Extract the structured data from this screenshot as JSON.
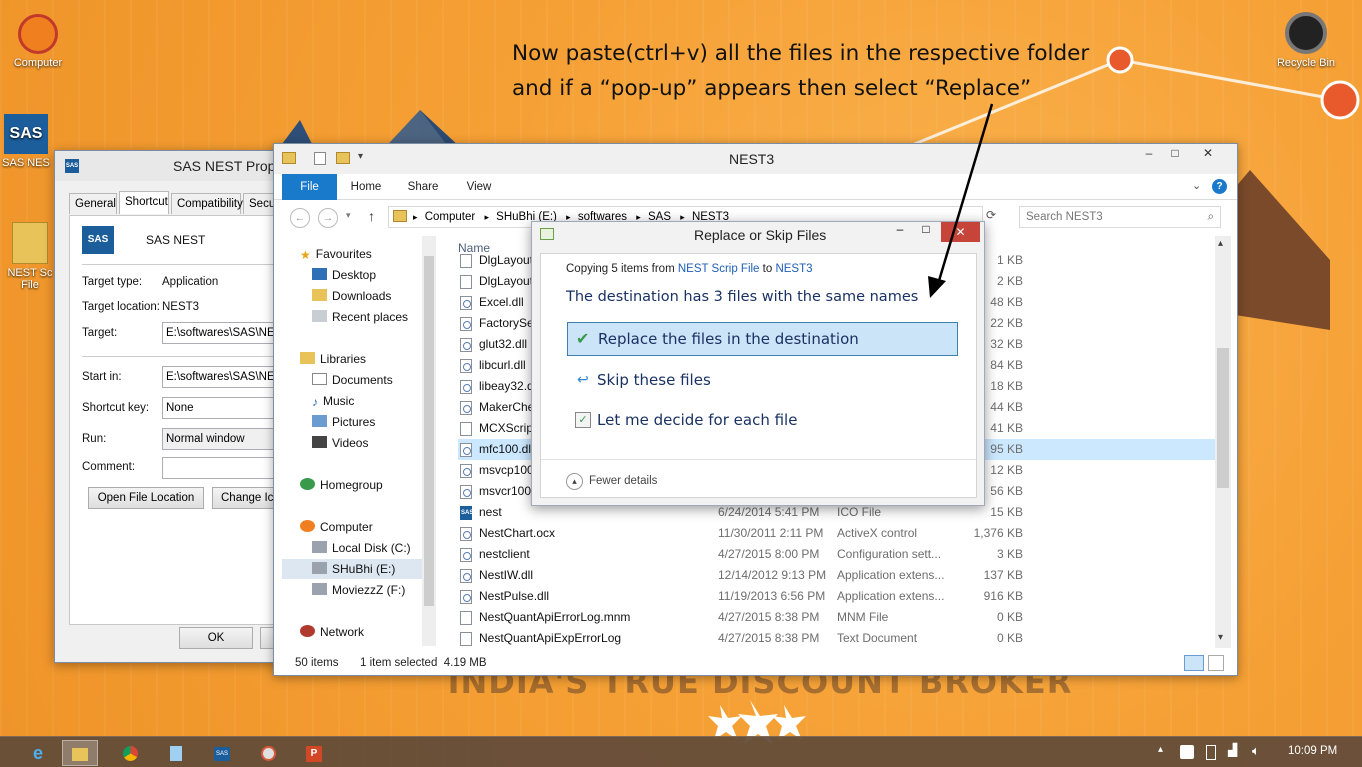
{
  "annotation": {
    "line1": "Now paste(ctrl+v) all the files in the respective folder",
    "line2": "and if a “pop-up” appears then select “Replace”"
  },
  "desktop_icons": [
    {
      "label": "Computer",
      "icon": "naruto-swirl-icon"
    },
    {
      "label": "Recycle Bin",
      "icon": "recycle-bin-icon"
    },
    {
      "label": "SAS NES",
      "icon": "sas-shortcut-icon"
    },
    {
      "label": "NEST Sc File",
      "icon": "zip-folder-icon"
    }
  ],
  "wallpaper_text": "INDIA'S TRUE DISCOUNT BROKER",
  "properties_window": {
    "title": "SAS NEST Prope",
    "icon_text": "SAS",
    "tabs": [
      "General",
      "Shortcut",
      "Compatibility",
      "Secu"
    ],
    "name": "SAS NEST",
    "target_type_label": "Target type:",
    "target_type_value": "Application",
    "target_location_label": "Target location:",
    "target_location_value": "NEST3",
    "target_label": "Target:",
    "target_value": "E:\\softwares\\SAS\\NES",
    "start_in_label": "Start in:",
    "start_in_value": "E:\\softwares\\SAS\\NES",
    "shortcut_key_label": "Shortcut key:",
    "shortcut_key_value": "None",
    "run_label": "Run:",
    "run_value": "Normal window",
    "comment_label": "Comment:",
    "comment_value": "",
    "open_file_location_btn": "Open File Location",
    "change_icon_btn": "Change Ico",
    "ok_btn": "OK"
  },
  "explorer": {
    "title": "NEST3",
    "ribbon_tabs": [
      "File",
      "Home",
      "Share",
      "View"
    ],
    "breadcrumb": [
      "Computer",
      "SHuBhi (E:)",
      "softwares",
      "SAS",
      "NEST3"
    ],
    "search_placeholder": "Search NEST3",
    "nav": {
      "favourites": "Favourites",
      "desktop": "Desktop",
      "downloads": "Downloads",
      "recent_places": "Recent places",
      "libraries": "Libraries",
      "documents": "Documents",
      "music": "Music",
      "pictures": "Pictures",
      "videos": "Videos",
      "homegroup": "Homegroup",
      "computer": "Computer",
      "local_disk": "Local Disk (C:)",
      "shubhi": "SHuBhi (E:)",
      "moviezz": "MoviezzZ (F:)",
      "network": "Network"
    },
    "column_name": "Name",
    "files": [
      {
        "name": "DlgLayout",
        "date": "",
        "type": "",
        "size": "1 KB",
        "icon": "file"
      },
      {
        "name": "DlgLayout",
        "date": "",
        "type": "",
        "size": "2 KB",
        "icon": "file"
      },
      {
        "name": "Excel.dll",
        "date": "",
        "type": "",
        "size": "48 KB",
        "icon": "dll"
      },
      {
        "name": "FactorySet",
        "date": "",
        "type": "",
        "size": "22 KB",
        "icon": "dll"
      },
      {
        "name": "glut32.dll",
        "date": "",
        "type": "",
        "size": "32 KB",
        "icon": "dll"
      },
      {
        "name": "libcurl.dll",
        "date": "",
        "type": "",
        "size": "84 KB",
        "icon": "dll"
      },
      {
        "name": "libeay32.dl",
        "date": "",
        "type": "",
        "size": "18 KB",
        "icon": "dll"
      },
      {
        "name": "MakerChe",
        "date": "",
        "type": "",
        "size": "44 KB",
        "icon": "dll"
      },
      {
        "name": "MCXScrip",
        "date": "",
        "type": "",
        "size": "41 KB",
        "icon": "file"
      },
      {
        "name": "mfc100.dl",
        "date": "",
        "type": "",
        "size": "95 KB",
        "icon": "dll"
      },
      {
        "name": "msvcp100",
        "date": "",
        "type": "",
        "size": "12 KB",
        "icon": "dll"
      },
      {
        "name": "msvcr100.",
        "date": "",
        "type": "",
        "size": "56 KB",
        "icon": "dll"
      },
      {
        "name": "nest",
        "date": "6/24/2014 5:41 PM",
        "type": "ICO File",
        "size": "15 KB",
        "icon": "sas"
      },
      {
        "name": "NestChart.ocx",
        "date": "11/30/2011 2:11 PM",
        "type": "ActiveX control",
        "size": "1,376 KB",
        "icon": "dll"
      },
      {
        "name": "nestclient",
        "date": "4/27/2015 8:00 PM",
        "type": "Configuration sett...",
        "size": "3 KB",
        "icon": "dll"
      },
      {
        "name": "NestIW.dll",
        "date": "12/14/2012 9:13 PM",
        "type": "Application extens...",
        "size": "137 KB",
        "icon": "dll"
      },
      {
        "name": "NestPulse.dll",
        "date": "11/19/2013 6:56 PM",
        "type": "Application extens...",
        "size": "916 KB",
        "icon": "dll"
      },
      {
        "name": "NestQuantApiErrorLog.mnm",
        "date": "4/27/2015 8:38 PM",
        "type": "MNM File",
        "size": "0 KB",
        "icon": "file"
      },
      {
        "name": "NestQuantApiExpErrorLog",
        "date": "4/27/2015 8:38 PM",
        "type": "Text Document",
        "size": "0 KB",
        "icon": "file"
      }
    ],
    "status_count": "50 items",
    "status_selected": "1 item selected  4.19 MB"
  },
  "dialog": {
    "title": "Replace or Skip Files",
    "copying_prefix": "Copying 5 items from",
    "source": "NEST Scrip File",
    "to_word": "to",
    "destination": "NEST3",
    "heading": "The destination has 3 files with the same names",
    "option_replace": "Replace the files in the destination",
    "option_skip": "Skip these files",
    "option_decide": "Let me decide for each file",
    "fewer_details": "Fewer details"
  },
  "taskbar": {
    "apps": [
      "ie-icon",
      "file-explorer-icon",
      "chrome-icon",
      "notepad-icon",
      "sas-icon",
      "paint-icon",
      "powerpoint-icon"
    ],
    "clock": "10:09 PM"
  },
  "colors": {
    "accent": "#1979ca",
    "wallpaper": "#f7a23a",
    "close": "#c7443a"
  }
}
